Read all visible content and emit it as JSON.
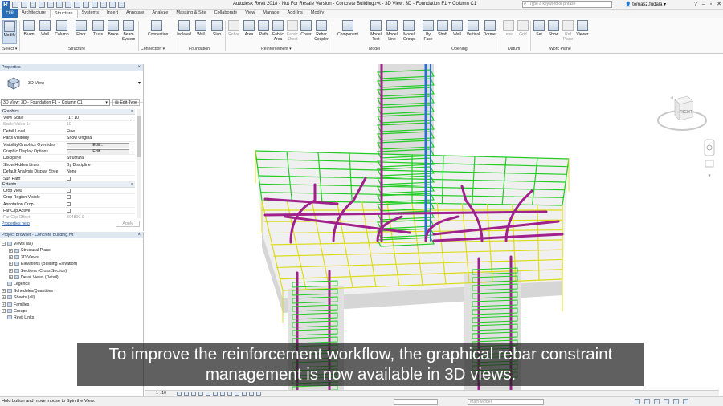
{
  "window": {
    "title": "Autodesk Revit 2018 - Not For Resale Version -  Concrete Building.rvt - 3D View: 3D - Foundation F1 + Column C1",
    "search_placeholder": "Type a keyword or phrase",
    "user": "tomasz.fudala"
  },
  "ribbon": {
    "file_tab": "File",
    "tabs": [
      "Architecture",
      "Structure",
      "Systems",
      "Insert",
      "Annotate",
      "Analyze",
      "Massing & Site",
      "Collaborate",
      "View",
      "Manage",
      "Add-Ins",
      "Modify"
    ],
    "active_tab": "Structure",
    "buttons": {
      "modify": "Modify",
      "beam": "Beam",
      "wall": "Wall",
      "column": "Column",
      "floor": "Floor",
      "truss": "Truss",
      "brace": "Brace",
      "beam_system": "Beam System",
      "connection": "Connection",
      "isolated": "Isolated",
      "wall_found": "Wall",
      "slab": "Slab",
      "rebar": "Rebar",
      "area": "Area",
      "path": "Path",
      "fabric_area": "Fabric Area",
      "fabric_sheet": "Fabric Sheet",
      "cover": "Cover",
      "rebar_coupler": "Rebar Coupler",
      "component": "Component",
      "model_text": "Model Text",
      "model_line": "Model Line",
      "model_group": "Model Group",
      "by_face": "By Face",
      "shaft": "Shaft",
      "open_wall": "Wall",
      "vertical": "Vertical",
      "dormer": "Dormer",
      "level": "Level",
      "grid": "Grid",
      "set": "Set",
      "show": "Show",
      "ref_plane": "Ref Plane",
      "viewer": "Viewer"
    },
    "groups": {
      "select": "Select ▾",
      "structure": "Structure",
      "connection": "Connection ▾",
      "foundation": "Foundation",
      "reinforcement": "Reinforcement ▾",
      "model": "Model",
      "opening": "Opening",
      "datum": "Datum",
      "work_plane": "Work Plane"
    }
  },
  "properties": {
    "title": "Properties",
    "type_name": "3D View",
    "view_selector": "3D View: 3D - Foundation F1 + Column C1",
    "edit_type": "Edit Type",
    "sections": {
      "graphics": "Graphics",
      "extents": "Extents",
      "collapse": "≈"
    },
    "graphics_rows": [
      {
        "key": "View Scale",
        "value": "1 : 10",
        "kind": "input"
      },
      {
        "key": "Scale Value    1:",
        "value": "10",
        "kind": "dim"
      },
      {
        "key": "Detail Level",
        "value": "Fine",
        "kind": "text"
      },
      {
        "key": "Parts Visibility",
        "value": "Show Original",
        "kind": "text"
      },
      {
        "key": "Visibility/Graphics Overrides",
        "value": "Edit...",
        "kind": "button"
      },
      {
        "key": "Graphic Display Options",
        "value": "Edit...",
        "kind": "button"
      },
      {
        "key": "Discipline",
        "value": "Structural",
        "kind": "text"
      },
      {
        "key": "Show Hidden Lines",
        "value": "By Discipline",
        "kind": "text"
      },
      {
        "key": "Default Analysis Display Style",
        "value": "None",
        "kind": "text"
      },
      {
        "key": "Sun Path",
        "value": "",
        "kind": "check"
      }
    ],
    "extents_rows": [
      {
        "key": "Crop View",
        "value": "",
        "kind": "check"
      },
      {
        "key": "Crop Region Visible",
        "value": "",
        "kind": "check"
      },
      {
        "key": "Annotation Crop",
        "value": "",
        "kind": "check"
      },
      {
        "key": "Far Clip Active",
        "value": "",
        "kind": "check"
      },
      {
        "key": "Far Clip Offset",
        "value": "304800.0",
        "kind": "dim"
      }
    ],
    "help_link": "Properties help",
    "apply": "Apply"
  },
  "project_browser": {
    "title": "Project Browser - Concrete Building.rvt",
    "tree": [
      {
        "label": "Views (all)",
        "depth": 0,
        "expander": "−"
      },
      {
        "label": "Structural Plans",
        "depth": 1,
        "expander": "+"
      },
      {
        "label": "3D Views",
        "depth": 1,
        "expander": "+"
      },
      {
        "label": "Elevations (Building Elevation)",
        "depth": 1,
        "expander": "+"
      },
      {
        "label": "Sections (Cross Section)",
        "depth": 1,
        "expander": "+"
      },
      {
        "label": "Detail Views (Detail)",
        "depth": 1,
        "expander": "+"
      },
      {
        "label": "Legends",
        "depth": 0,
        "expander": ""
      },
      {
        "label": "Schedules/Quantities",
        "depth": 0,
        "expander": "+"
      },
      {
        "label": "Sheets (all)",
        "depth": 0,
        "expander": "+"
      },
      {
        "label": "Families",
        "depth": 0,
        "expander": "+"
      },
      {
        "label": "Groups",
        "depth": 0,
        "expander": "+"
      },
      {
        "label": "Revit Links",
        "depth": 0,
        "expander": ""
      }
    ]
  },
  "viewport": {
    "caption": "To improve the reinforcement workflow, the graphical rebar constraint management is now available in 3D views.",
    "viewcube_label": "RIGHT",
    "colors": {
      "rebar_green": "#22cc22",
      "rebar_yellow": "#dcdc1e",
      "rebar_magenta": "#a0208c",
      "rebar_blue": "#2b6fd6",
      "concrete": "#d9d9d9"
    }
  },
  "view_control": {
    "scale": "1 : 10"
  },
  "status_bar": {
    "text": "Hold button and move mouse to Spin the View.",
    "workset": "Main Model"
  }
}
